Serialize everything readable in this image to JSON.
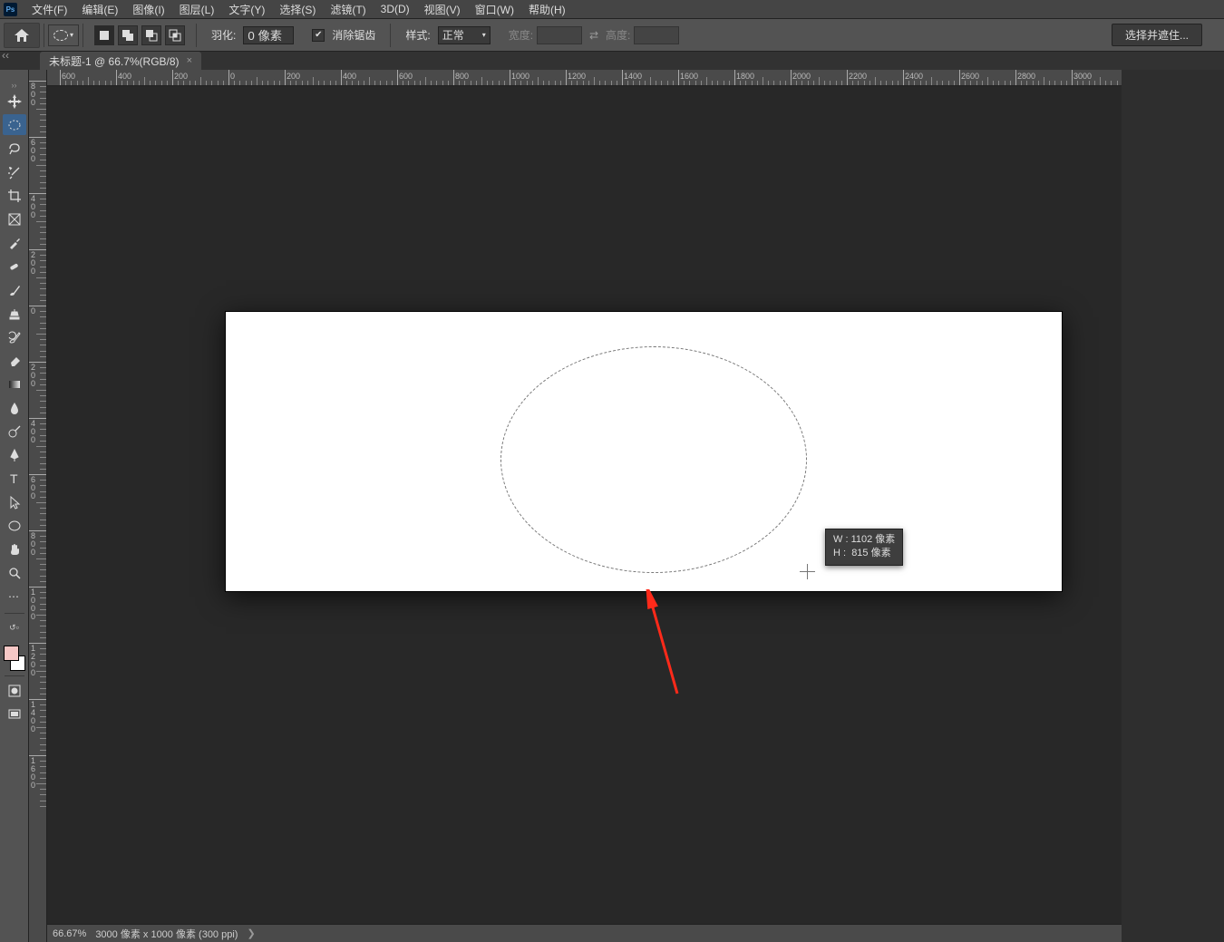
{
  "menu": {
    "items": [
      "文件(F)",
      "编辑(E)",
      "图像(I)",
      "图层(L)",
      "文字(Y)",
      "选择(S)",
      "滤镜(T)",
      "3D(D)",
      "视图(V)",
      "窗口(W)",
      "帮助(H)"
    ]
  },
  "options": {
    "feather_label": "羽化:",
    "feather_value": "0 像素",
    "antialias_label": "消除锯齿",
    "style_label": "样式:",
    "style_value": "正常",
    "width_label": "宽度:",
    "height_label": "高度:",
    "mask_button": "选择并遮住..."
  },
  "tabs": {
    "items": [
      {
        "label": "未标题-1 @ 66.7%(RGB/8)"
      }
    ]
  },
  "ruler": {
    "horizontal": [
      "600",
      "400",
      "200",
      "0",
      "200",
      "400",
      "600",
      "800",
      "1000",
      "1200",
      "1400",
      "1600",
      "1800",
      "2000",
      "2200",
      "2400",
      "2600",
      "2800",
      "3000"
    ],
    "vertical": [
      "800",
      "600",
      "400",
      "200",
      "0",
      "200",
      "400",
      "600",
      "800",
      "1000",
      "1200",
      "1400",
      "1600"
    ]
  },
  "selection_info": {
    "w_label": "W :",
    "w_value": "1102",
    "h_label": "H :",
    "h_value": "815",
    "unit": "像素"
  },
  "status": {
    "zoom": "66.67%",
    "doc": "3000 像素 x 1000 像素 (300 ppi)"
  },
  "tools": [
    {
      "name": "move-tool"
    },
    {
      "name": "elliptical-marquee-tool",
      "selected": true
    },
    {
      "name": "lasso-tool"
    },
    {
      "name": "magic-wand-tool"
    },
    {
      "name": "crop-tool"
    },
    {
      "name": "frame-tool"
    },
    {
      "name": "eyedropper-tool"
    },
    {
      "name": "healing-brush-tool"
    },
    {
      "name": "brush-tool"
    },
    {
      "name": "clone-stamp-tool"
    },
    {
      "name": "history-brush-tool"
    },
    {
      "name": "eraser-tool"
    },
    {
      "name": "gradient-tool"
    },
    {
      "name": "blur-tool"
    },
    {
      "name": "dodge-tool"
    },
    {
      "name": "pen-tool"
    },
    {
      "name": "type-tool"
    },
    {
      "name": "path-selection-tool"
    },
    {
      "name": "shape-tool"
    },
    {
      "name": "hand-tool"
    },
    {
      "name": "zoom-tool"
    }
  ]
}
